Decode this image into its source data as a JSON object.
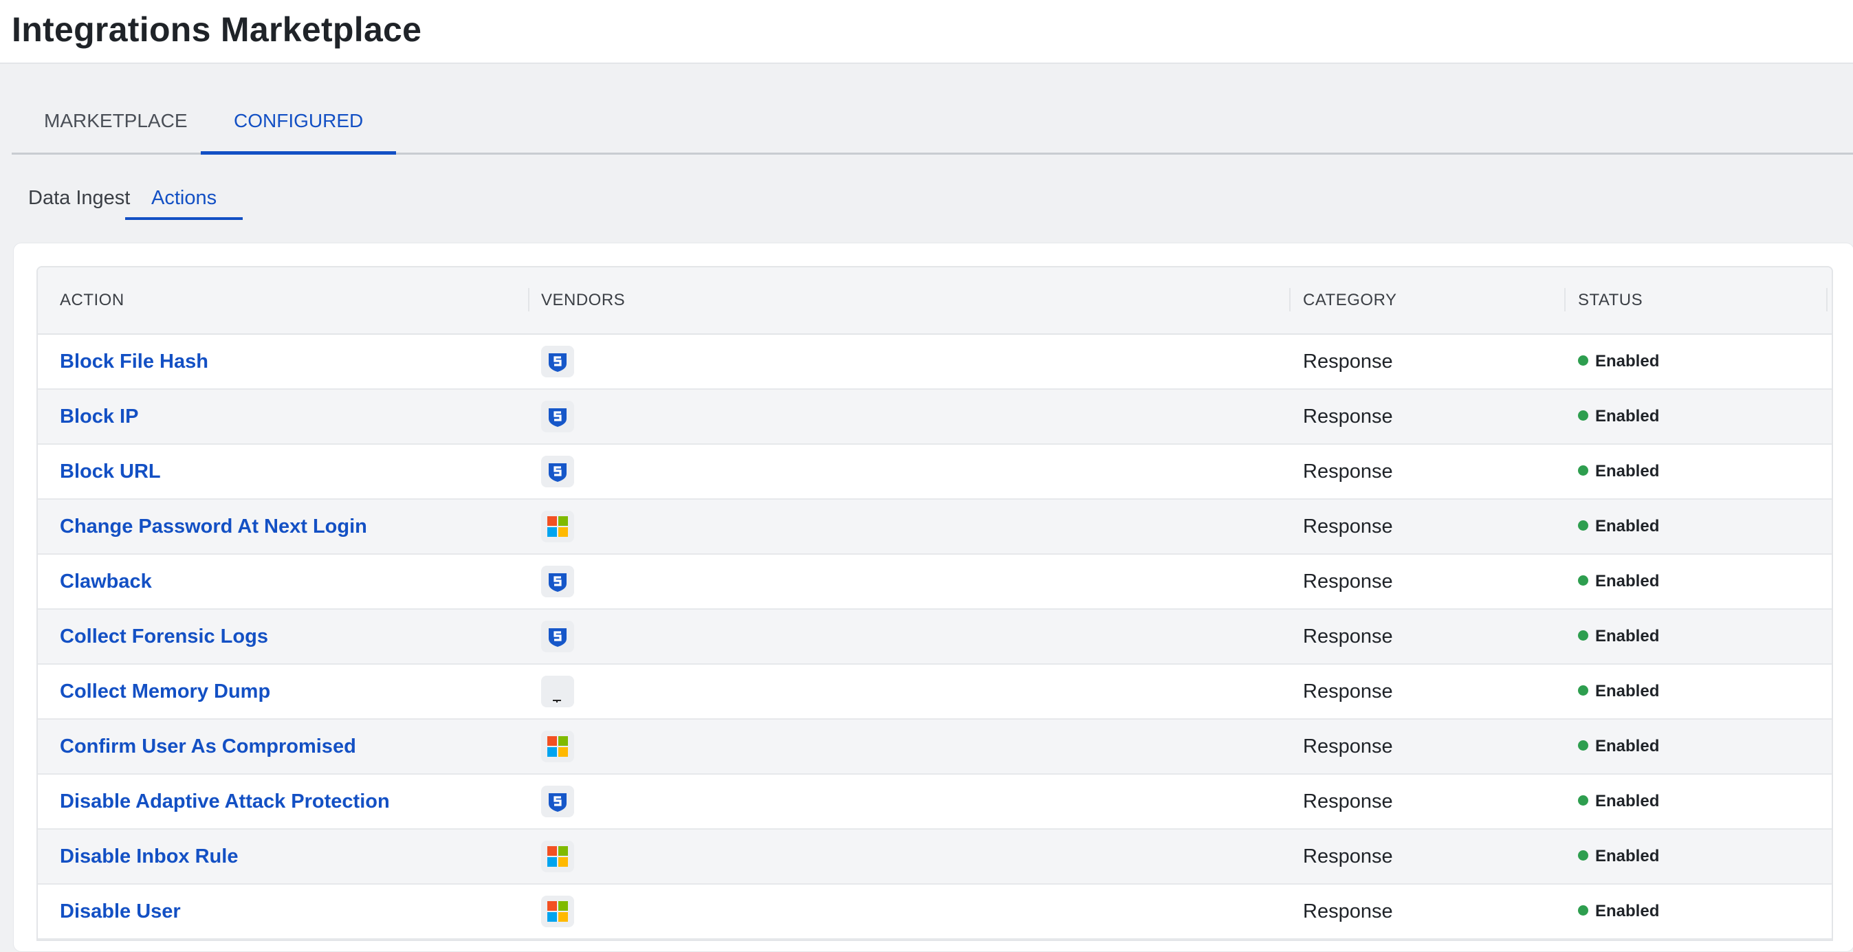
{
  "page": {
    "title": "Integrations Marketplace"
  },
  "tabs": {
    "marketplace": "MARKETPLACE",
    "configured": "CONFIGURED"
  },
  "subtabs": {
    "data_ingest": "Data Ingest",
    "actions": "Actions"
  },
  "table": {
    "headers": {
      "action": "ACTION",
      "vendors": "VENDORS",
      "category": "CATEGORY",
      "status": "STATUS"
    },
    "rows": [
      {
        "action": "Block File Hash",
        "vendor_icon": "shield-s-icon",
        "category": "Response",
        "status": "Enabled"
      },
      {
        "action": "Block IP",
        "vendor_icon": "shield-s-icon",
        "category": "Response",
        "status": "Enabled"
      },
      {
        "action": "Block URL",
        "vendor_icon": "shield-s-icon",
        "category": "Response",
        "status": "Enabled"
      },
      {
        "action": "Change Password At Next Login",
        "vendor_icon": "microsoft-icon",
        "category": "Response",
        "status": "Enabled"
      },
      {
        "action": "Clawback",
        "vendor_icon": "shield-s-icon",
        "category": "Response",
        "status": "Enabled"
      },
      {
        "action": "Collect Forensic Logs",
        "vendor_icon": "shield-s-icon",
        "category": "Response",
        "status": "Enabled"
      },
      {
        "action": "Collect Memory Dump",
        "vendor_icon": "generic-vendor-icon",
        "category": "Response",
        "status": "Enabled"
      },
      {
        "action": "Confirm User As Compromised",
        "vendor_icon": "microsoft-icon",
        "category": "Response",
        "status": "Enabled"
      },
      {
        "action": "Disable Adaptive Attack Protection",
        "vendor_icon": "shield-s-icon",
        "category": "Response",
        "status": "Enabled"
      },
      {
        "action": "Disable Inbox Rule",
        "vendor_icon": "microsoft-icon",
        "category": "Response",
        "status": "Enabled"
      },
      {
        "action": "Disable User",
        "vendor_icon": "microsoft-icon",
        "category": "Response",
        "status": "Enabled"
      }
    ]
  },
  "colors": {
    "accent": "#1350c4",
    "status_enabled": "#2e9e4f",
    "shield_blue": "#1657c9",
    "ms_red": "#f25022",
    "ms_green": "#7fba00",
    "ms_blue": "#00a4ef",
    "ms_yellow": "#ffb900"
  }
}
